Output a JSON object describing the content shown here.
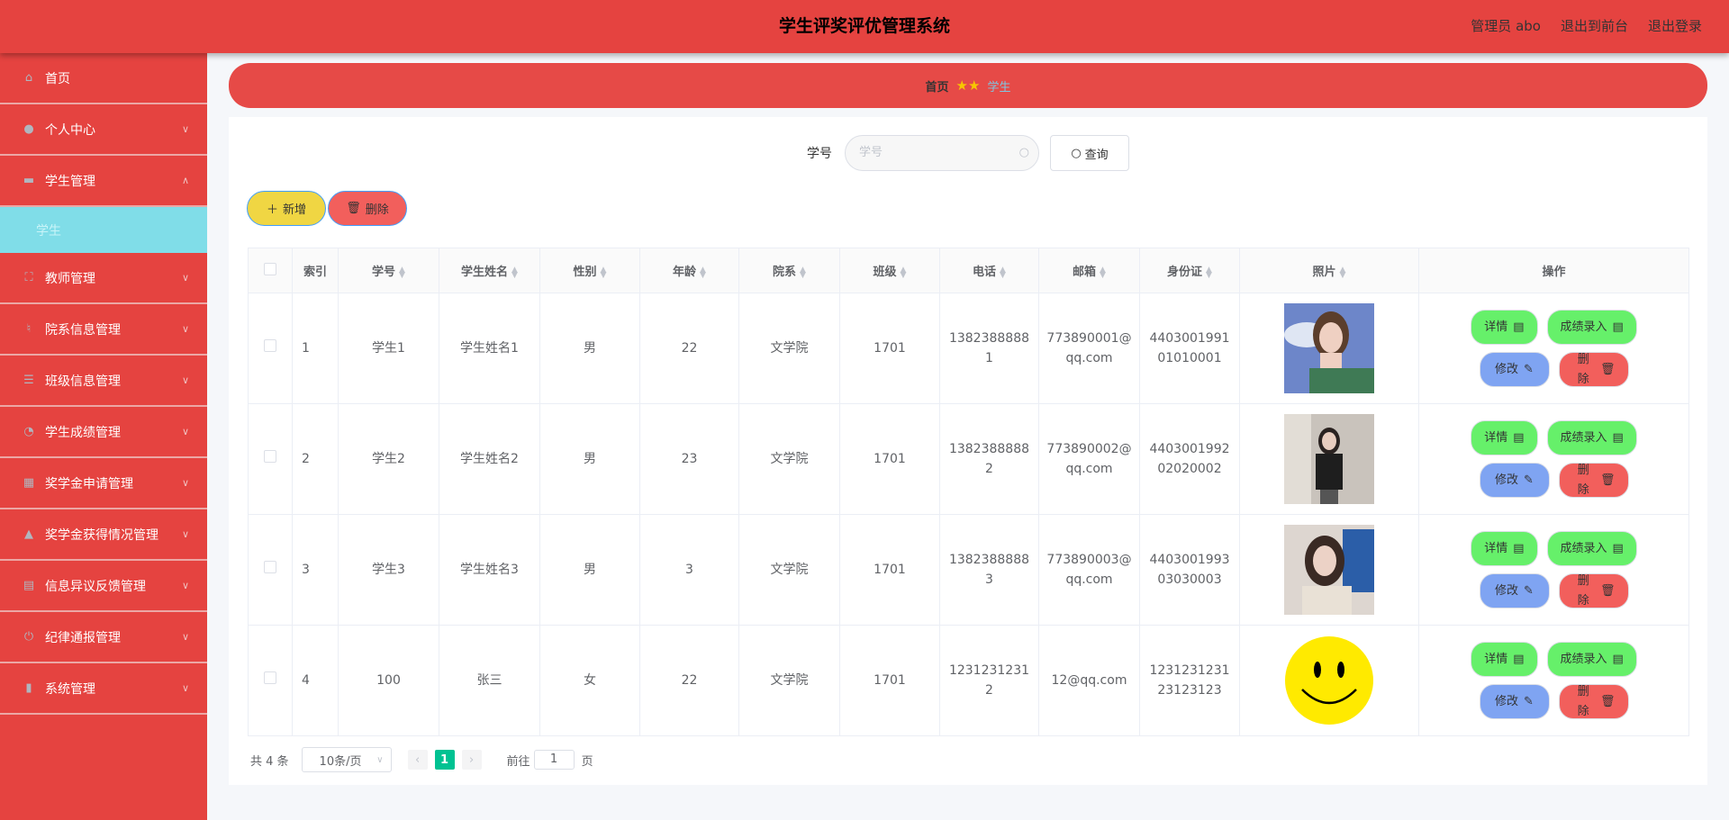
{
  "header": {
    "title": "学生评奖评优管理系统",
    "user": "管理员 abo",
    "to_front": "退出到前台",
    "logout": "退出登录"
  },
  "sidebar": {
    "items": [
      {
        "label": "首页",
        "icon": "home-icon"
      },
      {
        "label": "个人中心",
        "icon": "user-icon"
      },
      {
        "label": "学生管理",
        "icon": "chat-icon",
        "expanded": true,
        "children": [
          {
            "label": "学生"
          }
        ]
      },
      {
        "label": "教师管理",
        "icon": "frame-icon"
      },
      {
        "label": "院系信息管理",
        "icon": "microphone-icon"
      },
      {
        "label": "班级信息管理",
        "icon": "list-icon"
      },
      {
        "label": "学生成绩管理",
        "icon": "gauge-icon"
      },
      {
        "label": "奖学金申请管理",
        "icon": "grid-icon"
      },
      {
        "label": "奖学金获得情况管理",
        "icon": "thumb-icon"
      },
      {
        "label": "信息异议反馈管理",
        "icon": "printer-icon"
      },
      {
        "label": "纪律通报管理",
        "icon": "power-icon"
      },
      {
        "label": "系统管理",
        "icon": "chart-icon"
      }
    ]
  },
  "breadcrumb": {
    "home": "首页",
    "current": "学生"
  },
  "search": {
    "label": "学号",
    "placeholder": "学号",
    "button": "查询"
  },
  "toolbar": {
    "add": "新增",
    "delete": "删除"
  },
  "table": {
    "headers": [
      "索引",
      "学号",
      "学生姓名",
      "性别",
      "年龄",
      "院系",
      "班级",
      "电话",
      "邮箱",
      "身份证",
      "照片",
      "操作"
    ],
    "rows": [
      {
        "index": "1",
        "id": "学生1",
        "name": "学生姓名1",
        "gender": "男",
        "age": "22",
        "dept": "文学院",
        "class": "1701",
        "phone": "13823888881",
        "email": "773890001@qq.com",
        "idcard": "440300199101010001",
        "photo": "woman-sky"
      },
      {
        "index": "2",
        "id": "学生2",
        "name": "学生姓名2",
        "gender": "男",
        "age": "23",
        "dept": "文学院",
        "class": "1701",
        "phone": "13823888882",
        "email": "773890002@qq.com",
        "idcard": "440300199202020002",
        "photo": "woman-stairs"
      },
      {
        "index": "3",
        "id": "学生3",
        "name": "学生姓名3",
        "gender": "男",
        "age": "3",
        "dept": "文学院",
        "class": "1701",
        "phone": "13823888883",
        "email": "773890003@qq.com",
        "idcard": "440300199303030003",
        "photo": "woman-window"
      },
      {
        "index": "4",
        "id": "100",
        "name": "张三",
        "gender": "女",
        "age": "22",
        "dept": "文学院",
        "class": "1701",
        "phone": "12312312312",
        "email": "12@qq.com",
        "idcard": "123123123123123123",
        "photo": "smiley"
      }
    ],
    "ops": {
      "detail": "详情",
      "score": "成绩录入",
      "edit": "修改",
      "delete": "删除"
    }
  },
  "pagination": {
    "total": "共 4 条",
    "page_size": "10条/页",
    "current": "1",
    "goto_label": "前往",
    "goto_value": "1",
    "page_suffix": "页"
  },
  "colors": {
    "primary": "#e54340",
    "active_sub": "#80dde8",
    "green": "#66f06a",
    "blue": "#7fa4f2",
    "red": "#f25f5c",
    "yellow": "#f0d643",
    "pager": "#00c292"
  }
}
